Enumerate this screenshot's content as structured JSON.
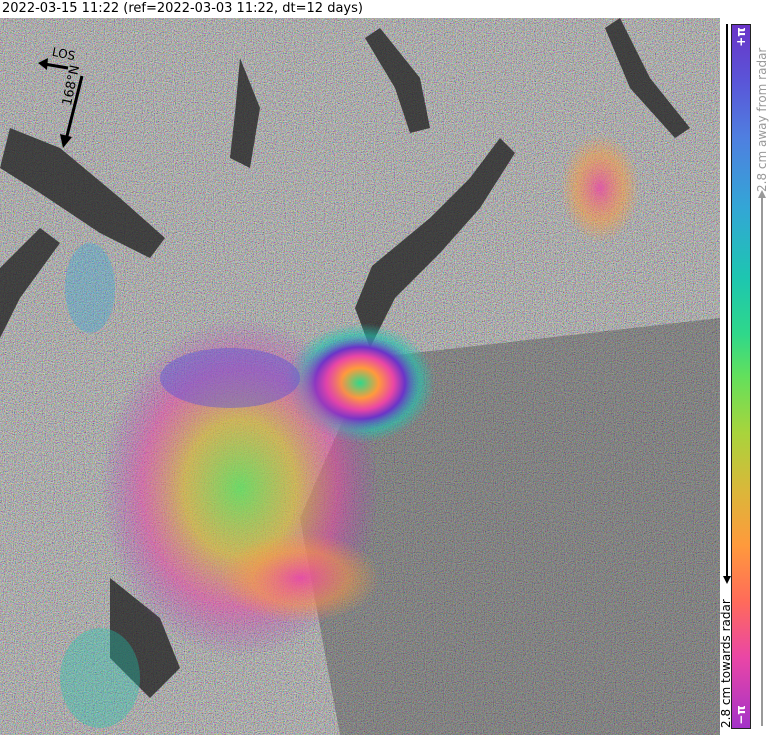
{
  "title": "2022-03-15 11:22 (ref=2022-03-03 11:22, dt=12 days)",
  "compass": {
    "los_label": "LOS",
    "heading_label": "168°N"
  },
  "colorbar": {
    "top_label": "+π",
    "bottom_label": "−π",
    "away_label": "2.8 cm away from radar",
    "towards_label": "2.8 cm towards radar"
  },
  "colors": {
    "phase_top": "#6a34c8",
    "phase_bottom": "#a432c8"
  }
}
